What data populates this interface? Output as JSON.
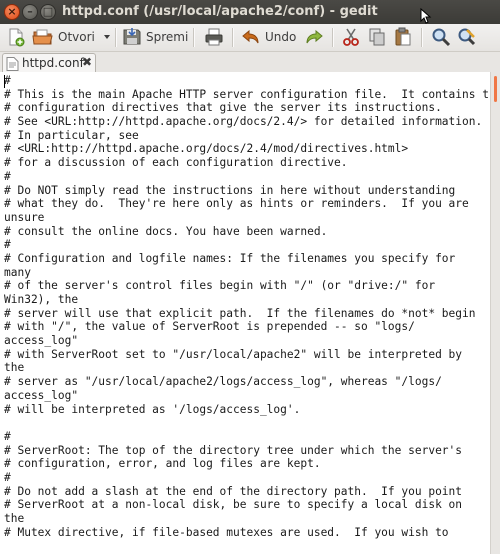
{
  "window": {
    "title": "httpd.conf (/usr/local/apache2/conf) - gedit",
    "close_glyph": "×",
    "min_glyph": "–",
    "max_glyph": "□"
  },
  "toolbar": {
    "open_label": "Otvori",
    "save_label": "Spremi",
    "undo_label": "Undo",
    "accent": "#f07746"
  },
  "tabs": [
    {
      "label": "httpd.conf",
      "close_glyph": "✖"
    }
  ],
  "editor": {
    "lines": [
      "#",
      "# This is the main Apache HTTP server configuration file.  It contains the",
      "# configuration directives that give the server its instructions.",
      "# See <URL:http://httpd.apache.org/docs/2.4/> for detailed information.",
      "# In particular, see",
      "# <URL:http://httpd.apache.org/docs/2.4/mod/directives.html>",
      "# for a discussion of each configuration directive.",
      "#",
      "# Do NOT simply read the instructions in here without understanding",
      "# what they do.  They're here only as hints or reminders.  If you are",
      "unsure",
      "# consult the online docs. You have been warned.",
      "#",
      "# Configuration and logfile names: If the filenames you specify for",
      "many",
      "# of the server's control files begin with \"/\" (or \"drive:/\" for",
      "Win32), the",
      "# server will use that explicit path.  If the filenames do *not* begin",
      "# with \"/\", the value of ServerRoot is prepended -- so \"logs/",
      "access_log\"",
      "# with ServerRoot set to \"/usr/local/apache2\" will be interpreted by",
      "the",
      "# server as \"/usr/local/apache2/logs/access_log\", whereas \"/logs/",
      "access_log\"",
      "# will be interpreted as '/logs/access_log'.",
      "",
      "#",
      "# ServerRoot: The top of the directory tree under which the server's",
      "# configuration, error, and log files are kept.",
      "#",
      "# Do not add a slash at the end of the directory path.  If you point",
      "# ServerRoot at a non-local disk, be sure to specify a local disk on",
      "the",
      "# Mutex directive, if file-based mutexes are used.  If you wish to"
    ]
  }
}
